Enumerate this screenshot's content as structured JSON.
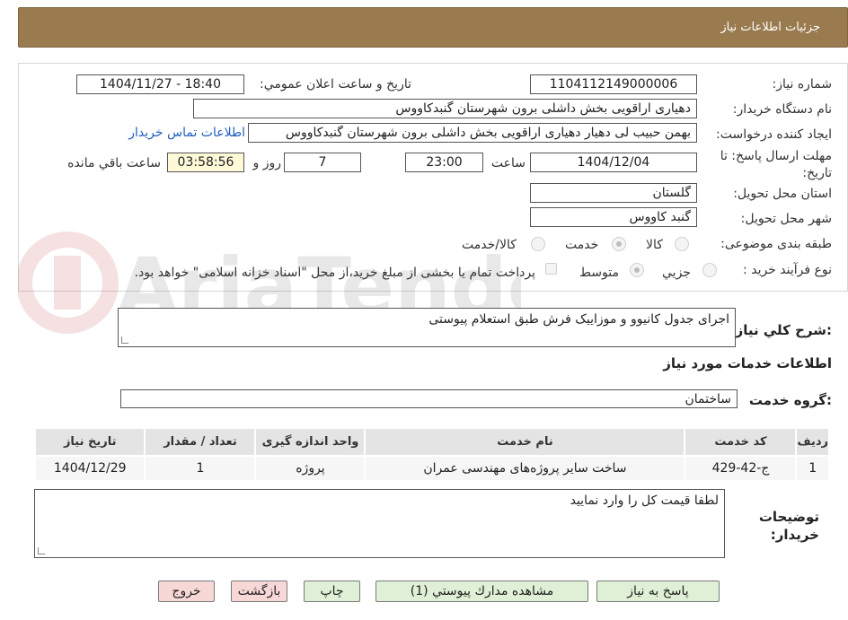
{
  "header": {
    "title": "جزئيات اطلاعات نياز"
  },
  "fields": {
    "need_number_label": "شماره نياز:",
    "need_number": "1104112149000006",
    "announce_label": "تاريخ و ساعت اعلان عمومي:",
    "announce_value": "1404/11/27 - 18:40",
    "buyer_org_label": "نام دستگاه خريدار:",
    "buyer_org": "دهیاری اراقویی بخش داشلی برون شهرستان گنبدکاووس",
    "creator_label": "ايجاد كننده درخواست:",
    "creator": "بهمن حبیب لی دهیار دهیاری اراقویی بخش داشلی برون شهرستان گنبدکاووس",
    "contact_link": "اطلاعات تماس خريدار",
    "deadline_label": "مهلت ارسال پاسخ: تا تاريخ:",
    "deadline_date": "1404/12/04",
    "time_label": "ساعت",
    "deadline_time": "23:00",
    "days_value": "7",
    "days_label": "روز و",
    "remaining_time": "03:58:56",
    "remaining_label": "ساعت باقي مانده",
    "province_label": "استان محل تحويل:",
    "province": "گلستان",
    "city_label": "شهر محل تحويل:",
    "city": "گنبد کاووس",
    "category_label": "طبقه بندی موضوعی:",
    "category_options": [
      "كالا",
      "خدمت",
      "كالا/خدمت"
    ],
    "process_label": "نوع فرآيند خريد :",
    "process_options": [
      "جزيي",
      "متوسط"
    ],
    "payment_note": "پرداخت تمام یا بخشی از مبلغ خرید،از محل \"اسناد خزانه اسلامی\" خواهد بود."
  },
  "description": {
    "label": "شرح كلي نياز:",
    "text": "اجرای جدول کانیوو و موزاییک فرش طبق استعلام پیوستی"
  },
  "services": {
    "section_title": "اطلاعات خدمات مورد نياز",
    "group_label": "گروه خدمت:",
    "group_value": "ساختمان",
    "columns": [
      "رديف",
      "كد خدمت",
      "نام خدمت",
      "واحد اندازه گيری",
      "تعداد / مقدار",
      "تاريخ نياز"
    ],
    "rows": [
      [
        "1",
        "ج-42-429",
        "ساخت سایر پروژه‌های مهندسی عمران",
        "پروژه",
        "1",
        "1404/12/29"
      ]
    ]
  },
  "buyer_notes": {
    "label": "توضيحات خريدار:",
    "text": "لطفا قیمت کل را وارد نمایید"
  },
  "buttons": {
    "reply": "پاسخ به نياز",
    "attachments": "مشاهده مدارك پيوستي (1)",
    "print": "چاپ",
    "back": "بازگشت",
    "exit": "خروج"
  },
  "colors": {
    "header_bg": "#9a7b4f",
    "link": "#1f5fbf",
    "button_green": "#dff0d6",
    "button_pink": "#f8d7d7"
  }
}
